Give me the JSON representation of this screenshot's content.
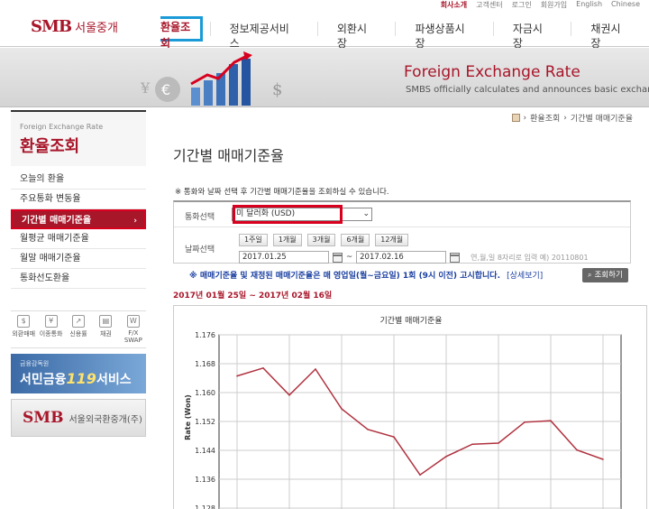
{
  "utility": [
    "회사소개",
    "고객센터",
    "로그인",
    "회원가입",
    "English",
    "Chinese"
  ],
  "header": {
    "logo_mark": "SMB",
    "logo_text": "서울중개",
    "nav": [
      "환율조회",
      "정보제공서비스",
      "외환시장",
      "파생상품시장",
      "자금시장",
      "채권시장"
    ]
  },
  "banner": {
    "title": "Foreign Exchange Rate",
    "subtitle": "SMBS officially calculates and announces basic exchange rate"
  },
  "sidebar": {
    "en_title": "Foreign Exchange Rate",
    "ko_title": "환율조회",
    "items": [
      "오늘의 환율",
      "주요통화 변동율",
      "기간별 매매기준율",
      "월평균 매매기준율",
      "월말 매매기준율",
      "통화선도환율"
    ],
    "active_index": 2,
    "arrow": "›",
    "quick": [
      {
        "label": "외환매매",
        "icon": "exchange-icon"
      },
      {
        "label": "이종통화",
        "icon": "cross-currency-icon"
      },
      {
        "label": "신용률",
        "icon": "chart-icon"
      },
      {
        "label": "채권",
        "icon": "bond-icon"
      },
      {
        "label": "F/X SWAP",
        "icon": "swap-icon"
      }
    ],
    "banner1_small": "금융감독원",
    "banner1_pre": "서민금융",
    "banner1_num": "119",
    "banner1_post": "서비스",
    "banner2_mark": "SMB",
    "banner2_text": "서울외국환중개(주)"
  },
  "breadcrumb": [
    "환율조회",
    "기간별 매매기준율"
  ],
  "breadcrumb_sep": "›",
  "page_title": "기간별 매매기준율",
  "notice": "※ 통화와 날짜 선택 후 기간별 매매기준율을 조회하실 수 있습니다.",
  "search": {
    "currency_label": "통화선택",
    "currency_value": "미 달러화 (USD)",
    "period_label": "날짜선택",
    "periods": [
      "1주일",
      "1개월",
      "3개월",
      "6개월",
      "12개월"
    ],
    "start_date": "2017.01.25",
    "date_sep": "~",
    "end_date": "2017.02.16",
    "date_hint": "연,월,일 8자리로 입력 예) 20110801"
  },
  "notice2": "※ 매매기준율 및 재정된 매매기준율은 매 영업일(월~금요일) 1회 (9시 이전) 고시합니다.",
  "notice2_link": "[상세보기]",
  "query_button": "조회하기",
  "range_text": "2017년 01월 25일 ~ 2017년 02월 16일",
  "chart_data": {
    "type": "line",
    "title": "기간별 매매기준율",
    "ylabel": "Rate (Won)",
    "xlabel": "",
    "ylim": [
      1.124,
      1.176
    ],
    "yticks": [
      1.176,
      1.168,
      1.16,
      1.152,
      1.144,
      1.136,
      1.128
    ],
    "grid": true,
    "series": [
      {
        "color": "#b0323f",
        "values": [
          1.1646,
          1.1668,
          1.1593,
          1.1665,
          1.1555,
          1.1498,
          1.1477,
          1.1372,
          1.1423,
          1.1457,
          1.146,
          1.1518,
          1.1522,
          1.1441,
          1.1415
        ]
      }
    ]
  }
}
